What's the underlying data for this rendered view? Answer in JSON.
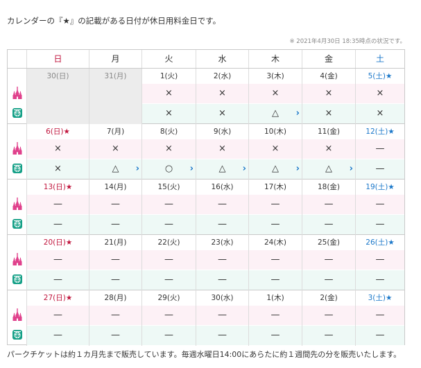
{
  "intro": "カレンダーの『★』の記載がある日付が休日用料金日です。",
  "note": "※ 2021年4月30日 18:35時点の状況です。",
  "footer": "パークチケットは約１カ月先まで販売しています。毎週水曜日14:00にあらたに約１週間先の分を販売いたします。",
  "weekdays": [
    "日",
    "月",
    "火",
    "水",
    "木",
    "金",
    "土"
  ],
  "icons": {
    "land": "castle-icon",
    "sea": "globe-icon"
  },
  "colors": {
    "sunday": "#c0143c",
    "saturday": "#1a77c9",
    "land_row": "#fdf1f6",
    "sea_row": "#eef9f6"
  },
  "weeks": [
    {
      "days": [
        {
          "date": "30(日)",
          "land": "",
          "sea": "",
          "prev": true
        },
        {
          "date": "31(月)",
          "land": "",
          "sea": "",
          "prev": true
        },
        {
          "date": "1(火)",
          "land": "×",
          "sea": "×"
        },
        {
          "date": "2(水)",
          "land": "×",
          "sea": "×"
        },
        {
          "date": "3(木)",
          "land": "×",
          "sea": "△",
          "sea_more": "›"
        },
        {
          "date": "4(金)",
          "land": "×",
          "sea": "×"
        },
        {
          "date": "5(土)★",
          "land": "×",
          "sea": "×"
        }
      ]
    },
    {
      "days": [
        {
          "date": "6(日)★",
          "land": "×",
          "sea": "×"
        },
        {
          "date": "7(月)",
          "land": "×",
          "sea": "△",
          "sea_more": "›"
        },
        {
          "date": "8(火)",
          "land": "×",
          "sea": "○",
          "sea_more": "›"
        },
        {
          "date": "9(水)",
          "land": "×",
          "sea": "△",
          "sea_more": "›"
        },
        {
          "date": "10(木)",
          "land": "×",
          "sea": "△",
          "sea_more": "›"
        },
        {
          "date": "11(金)",
          "land": "×",
          "sea": "△",
          "sea_more": "›"
        },
        {
          "date": "12(土)★",
          "land": "—",
          "sea": "—"
        }
      ]
    },
    {
      "days": [
        {
          "date": "13(日)★",
          "land": "—",
          "sea": "—"
        },
        {
          "date": "14(月)",
          "land": "—",
          "sea": "—"
        },
        {
          "date": "15(火)",
          "land": "—",
          "sea": "—"
        },
        {
          "date": "16(水)",
          "land": "—",
          "sea": "—"
        },
        {
          "date": "17(木)",
          "land": "—",
          "sea": "—"
        },
        {
          "date": "18(金)",
          "land": "—",
          "sea": "—"
        },
        {
          "date": "19(土)★",
          "land": "—",
          "sea": "—"
        }
      ]
    },
    {
      "days": [
        {
          "date": "20(日)★",
          "land": "—",
          "sea": "—"
        },
        {
          "date": "21(月)",
          "land": "—",
          "sea": "—"
        },
        {
          "date": "22(火)",
          "land": "—",
          "sea": "—"
        },
        {
          "date": "23(水)",
          "land": "—",
          "sea": "—"
        },
        {
          "date": "24(木)",
          "land": "—",
          "sea": "—"
        },
        {
          "date": "25(金)",
          "land": "—",
          "sea": "—"
        },
        {
          "date": "26(土)★",
          "land": "—",
          "sea": "—"
        }
      ]
    },
    {
      "days": [
        {
          "date": "27(日)★",
          "land": "—",
          "sea": "—"
        },
        {
          "date": "28(月)",
          "land": "—",
          "sea": "—"
        },
        {
          "date": "29(火)",
          "land": "—",
          "sea": "—"
        },
        {
          "date": "30(水)",
          "land": "—",
          "sea": "—"
        },
        {
          "date": "1(木)",
          "land": "—",
          "sea": "—"
        },
        {
          "date": "2(金)",
          "land": "—",
          "sea": "—"
        },
        {
          "date": "3(土)★",
          "land": "—",
          "sea": "—"
        }
      ]
    }
  ]
}
